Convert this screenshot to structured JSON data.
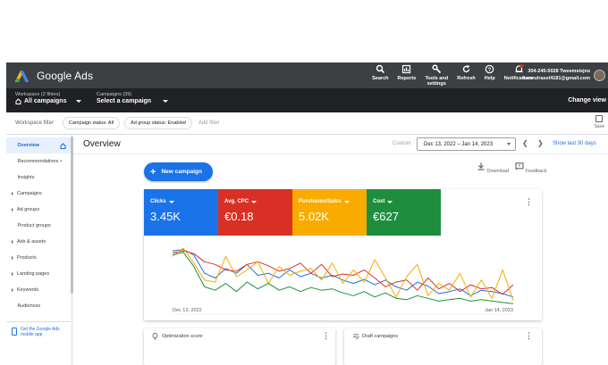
{
  "app": {
    "name": "Google Ads"
  },
  "toolbar": {
    "items": [
      {
        "label": "Search",
        "icon": "search-icon"
      },
      {
        "label": "Reports",
        "icon": "reports-icon"
      },
      {
        "label": "Tools and settings",
        "icon": "wrench-icon"
      },
      {
        "label": "Refresh",
        "icon": "refresh-icon"
      },
      {
        "label": "Help",
        "icon": "help-icon"
      },
      {
        "label": "Notifications",
        "icon": "bell-icon",
        "badge": "1"
      }
    ]
  },
  "account": {
    "phone": "304-245-5028 Tweemsisjns",
    "email": "kamrulrasel4181@gmail.com"
  },
  "workspace": {
    "label": "Workspace (2 filters)",
    "value": "All campaigns",
    "campaigns_label": "Campaigns (39)",
    "campaigns_value": "Select a campaign",
    "change_view": "Change view"
  },
  "filters": {
    "title": "Workspace filter",
    "chips": [
      "Campaign status: All",
      "Ad group status: Enabled"
    ],
    "add": "Add filter",
    "save": "Save"
  },
  "sidebar": {
    "items": [
      {
        "label": "Overview",
        "active": true,
        "expandable": false
      },
      {
        "label": "Recommendations",
        "active": false,
        "expandable": false
      },
      {
        "label": "Insights",
        "active": false,
        "expandable": false
      },
      {
        "label": "Campaigns",
        "active": false,
        "expandable": true
      },
      {
        "label": "Ad groups",
        "active": false,
        "expandable": true
      },
      {
        "label": "Product groups",
        "active": false,
        "expandable": false
      },
      {
        "label": "Ads & assets",
        "active": false,
        "expandable": true
      },
      {
        "label": "Products",
        "active": false,
        "expandable": true
      },
      {
        "label": "Landing pages",
        "active": false,
        "expandable": true
      },
      {
        "label": "Keywords",
        "active": false,
        "expandable": true
      },
      {
        "label": "Audiences",
        "active": false,
        "expandable": false
      }
    ],
    "mobile_app": "Get the Google Ads mobile app"
  },
  "overview": {
    "title": "Overview",
    "custom": "Custom",
    "date_range": "Dec 13, 2022 – Jan 14, 2023",
    "show_last": "Show last 30 days",
    "new_campaign": "New campaign",
    "download": "Download",
    "feedback": "Feedback"
  },
  "metrics": [
    {
      "label": "Clicks",
      "value": "3.45K",
      "color": "#1a73e8"
    },
    {
      "label": "Avg. CPC",
      "value": "€0.18",
      "color": "#d93025"
    },
    {
      "label": "Purchases/Sales",
      "value": "5.02K",
      "color": "#f9ab00"
    },
    {
      "label": "Cost",
      "value": "€627",
      "color": "#1e8e3e"
    }
  ],
  "chart_data": {
    "type": "line",
    "x_start": "Dec 13, 2022",
    "x_end": "Jan 14, 2023",
    "series": [
      {
        "name": "Clicks",
        "color": "#1a73e8",
        "values": [
          88,
          90,
          82,
          55,
          48,
          62,
          55,
          68,
          52,
          55,
          48,
          60,
          50,
          55,
          48,
          52,
          45,
          40,
          46,
          38,
          45,
          35,
          30,
          42,
          36,
          25,
          28,
          32,
          22,
          30,
          28,
          25,
          20
        ]
      },
      {
        "name": "Avg. CPC",
        "color": "#d93025",
        "values": [
          85,
          88,
          84,
          72,
          68,
          60,
          58,
          68,
          72,
          66,
          58,
          62,
          70,
          55,
          68,
          50,
          54,
          52,
          60,
          48,
          35,
          42,
          45,
          30,
          48,
          32,
          40,
          28,
          38,
          32,
          34,
          24,
          38
        ]
      },
      {
        "name": "Purchases/Sales",
        "color": "#f9ab00",
        "values": [
          80,
          92,
          70,
          45,
          42,
          80,
          50,
          60,
          72,
          40,
          65,
          52,
          58,
          62,
          45,
          70,
          40,
          60,
          42,
          75,
          48,
          20,
          50,
          68,
          22,
          40,
          30,
          55,
          20,
          45,
          18,
          60,
          15
        ]
      },
      {
        "name": "Cost",
        "color": "#1e8e3e",
        "values": [
          82,
          86,
          65,
          35,
          30,
          40,
          28,
          42,
          32,
          40,
          30,
          35,
          28,
          34,
          30,
          32,
          26,
          22,
          28,
          20,
          26,
          18,
          16,
          22,
          18,
          14,
          16,
          18,
          14,
          16,
          14,
          12,
          10
        ]
      }
    ]
  },
  "bottom_cards": [
    {
      "title": "Optimization score",
      "icon": "lightbulb-icon"
    },
    {
      "title": "Draft campaigns",
      "icon": "draft-icon"
    }
  ]
}
